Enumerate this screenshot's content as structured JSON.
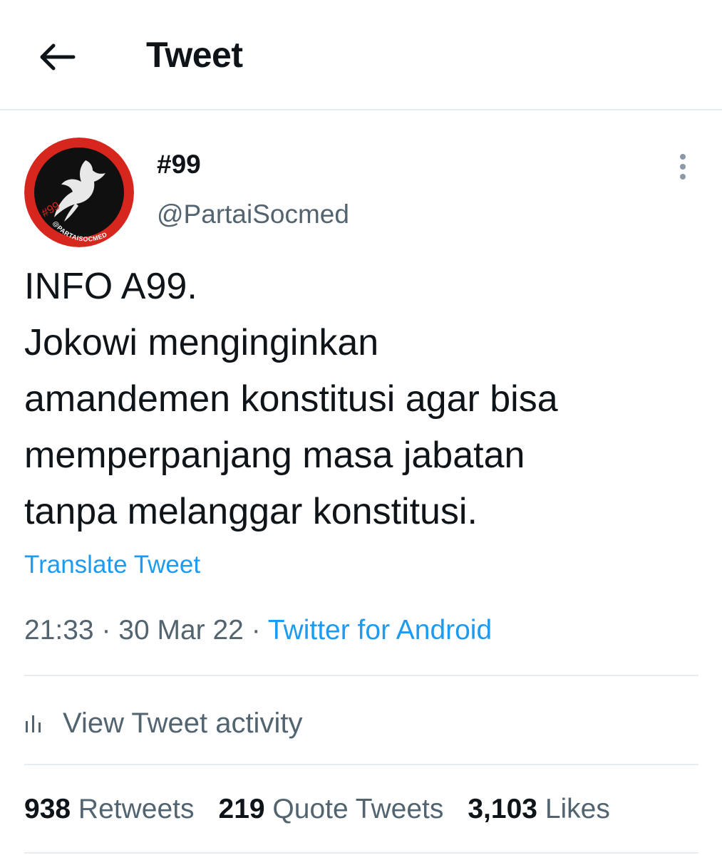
{
  "header": {
    "title": "Tweet",
    "back_icon": "arrow-left-icon"
  },
  "author": {
    "display_name": "#99",
    "username": "@PartaiSocmed",
    "avatar_text": "@PARTAISOCMED",
    "avatar_colors": {
      "ring": "#d7261e",
      "inner": "#101010",
      "bird": "#e8e8e8"
    }
  },
  "tweet": {
    "lines": [
      "INFO A99.",
      "Jokowi menginginkan",
      "amandemen konstitusi agar bisa",
      "memperpanjang masa jabatan",
      "tanpa melanggar konstitusi."
    ],
    "translate_label": "Translate Tweet",
    "time": "21:33",
    "date": "30 Mar 22",
    "separator": " · ",
    "source": "Twitter for Android"
  },
  "activity": {
    "label": "View Tweet activity",
    "icon": "bar-chart-icon"
  },
  "stats": {
    "retweets_count": "938",
    "retweets_label": "Retweets",
    "quotes_count": "219",
    "quotes_label": "Quote Tweets",
    "likes_count": "3,103",
    "likes_label": "Likes"
  },
  "colors": {
    "link": "#1d9bf0",
    "secondary_text": "#536471",
    "primary_text": "#0f1419",
    "divider": "#e6ecf0"
  }
}
